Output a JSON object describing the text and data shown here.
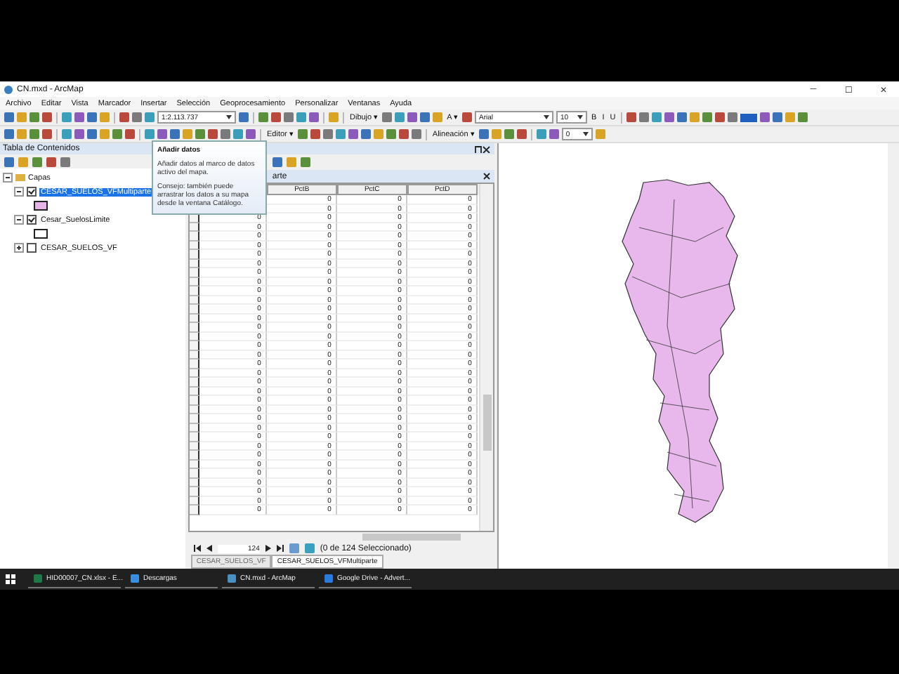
{
  "window": {
    "title": "CN.mxd - ArcMap",
    "controls": [
      "─",
      "☐",
      "✕"
    ]
  },
  "menu": [
    "Archivo",
    "Editar",
    "Vista",
    "Marcador",
    "Insertar",
    "Selección",
    "Geoprocesamiento",
    "Personalizar",
    "Ventanas",
    "Ayuda"
  ],
  "toolbar_1": [
    {
      "kind": "icon"
    },
    {
      "kind": "icon"
    },
    {
      "kind": "icon"
    },
    {
      "kind": "icon"
    },
    {
      "kind": "sep"
    },
    {
      "kind": "icon"
    },
    {
      "kind": "icon"
    },
    {
      "kind": "icon"
    },
    {
      "kind": "icon"
    },
    {
      "kind": "sep"
    },
    {
      "kind": "icon"
    },
    {
      "kind": "icon"
    },
    {
      "kind": "icon"
    },
    {
      "kind": "combo",
      "text": "1:2.113.737",
      "wide": true
    },
    {
      "kind": "icon"
    },
    {
      "kind": "sep"
    },
    {
      "kind": "icon"
    },
    {
      "kind": "icon"
    },
    {
      "kind": "icon"
    },
    {
      "kind": "icon"
    },
    {
      "kind": "icon"
    },
    {
      "kind": "sep"
    },
    {
      "kind": "icon"
    },
    {
      "kind": "sep"
    },
    {
      "kind": "label",
      "text": "Dibujo ▾"
    },
    {
      "kind": "icon"
    },
    {
      "kind": "icon"
    },
    {
      "kind": "icon"
    },
    {
      "kind": "icon"
    },
    {
      "kind": "icon"
    },
    {
      "kind": "label",
      "text": "A ▾"
    },
    {
      "kind": "icon"
    },
    {
      "kind": "combo",
      "text": "Arial",
      "wide": true
    },
    {
      "kind": "combo",
      "text": "10",
      "wide": false
    },
    {
      "kind": "label",
      "text": "B"
    },
    {
      "kind": "label",
      "text": "I"
    },
    {
      "kind": "label",
      "text": "U"
    },
    {
      "kind": "sep"
    },
    {
      "kind": "icon"
    },
    {
      "kind": "icon"
    },
    {
      "kind": "icon"
    },
    {
      "kind": "icon"
    },
    {
      "kind": "icon"
    },
    {
      "kind": "icon"
    },
    {
      "kind": "icon"
    },
    {
      "kind": "icon"
    },
    {
      "kind": "icon"
    },
    {
      "kind": "swatch"
    },
    {
      "kind": "icon"
    },
    {
      "kind": "icon"
    },
    {
      "kind": "icon"
    },
    {
      "kind": "icon"
    }
  ],
  "toolbar_2": [
    {
      "kind": "icon"
    },
    {
      "kind": "icon"
    },
    {
      "kind": "icon"
    },
    {
      "kind": "icon"
    },
    {
      "kind": "sep"
    },
    {
      "kind": "icon"
    },
    {
      "kind": "icon"
    },
    {
      "kind": "icon"
    },
    {
      "kind": "icon"
    },
    {
      "kind": "icon"
    },
    {
      "kind": "icon"
    },
    {
      "kind": "sep"
    },
    {
      "kind": "icon"
    },
    {
      "kind": "icon"
    },
    {
      "kind": "icon"
    },
    {
      "kind": "icon"
    },
    {
      "kind": "icon"
    },
    {
      "kind": "icon"
    },
    {
      "kind": "icon"
    },
    {
      "kind": "icon"
    },
    {
      "kind": "icon"
    },
    {
      "kind": "sep"
    },
    {
      "kind": "label",
      "text": "Editor ▾"
    },
    {
      "kind": "icon"
    },
    {
      "kind": "icon"
    },
    {
      "kind": "icon"
    },
    {
      "kind": "icon"
    },
    {
      "kind": "icon"
    },
    {
      "kind": "icon"
    },
    {
      "kind": "icon"
    },
    {
      "kind": "icon"
    },
    {
      "kind": "icon"
    },
    {
      "kind": "icon"
    },
    {
      "kind": "sep"
    },
    {
      "kind": "label",
      "text": "Alineación ▾"
    },
    {
      "kind": "icon"
    },
    {
      "kind": "icon"
    },
    {
      "kind": "icon"
    },
    {
      "kind": "icon"
    },
    {
      "kind": "sep"
    },
    {
      "kind": "icon"
    },
    {
      "kind": "icon"
    },
    {
      "kind": "combo",
      "text": "0",
      "wide": false
    },
    {
      "kind": "icon"
    }
  ],
  "toc": {
    "title": "Tabla de Contenidos",
    "root": "Capas",
    "layers": [
      {
        "name": "CESAR_SUELOS_VFMultiparte",
        "checked": true,
        "selected": true,
        "expanded": true,
        "color": "#e8b4e8"
      },
      {
        "name": "Cesar_SuelosLimite",
        "checked": true,
        "selected": false,
        "expanded": true,
        "color": "#ffffff"
      },
      {
        "name": "CESAR_SUELOS_VF",
        "checked": false,
        "selected": false,
        "expanded": false
      }
    ]
  },
  "table": {
    "window_title_tail": "arte",
    "columns": [
      "PctB",
      "PctC",
      "PctD"
    ],
    "rows": [
      [
        "0",
        "0",
        "0"
      ],
      [
        "0",
        "0",
        "0"
      ],
      [
        "0",
        "0",
        "0",
        "0"
      ],
      [
        "0",
        "0",
        "0",
        "0"
      ],
      [
        "0",
        "0",
        "0",
        "0"
      ],
      [
        "0",
        "0",
        "0",
        "0"
      ],
      [
        "0",
        "0",
        "0",
        "0"
      ],
      [
        "0",
        "0",
        "0",
        "0"
      ],
      [
        "0",
        "0",
        "0",
        "0"
      ],
      [
        "0",
        "0",
        "0",
        "0"
      ],
      [
        "0",
        "0",
        "0",
        "0"
      ],
      [
        "0",
        "0",
        "0",
        "0"
      ],
      [
        "0",
        "0",
        "0",
        "0"
      ],
      [
        "0",
        "0",
        "0",
        "0"
      ],
      [
        "0",
        "0",
        "0",
        "0"
      ],
      [
        "0",
        "0",
        "0",
        "0"
      ],
      [
        "0",
        "0",
        "0",
        "0"
      ],
      [
        "0",
        "0",
        "0",
        "0"
      ],
      [
        "0",
        "0",
        "0",
        "0"
      ],
      [
        "0",
        "0",
        "0",
        "0"
      ],
      [
        "0",
        "0",
        "0",
        "0"
      ],
      [
        "0",
        "0",
        "0",
        "0"
      ],
      [
        "0",
        "0",
        "0",
        "0"
      ],
      [
        "0",
        "0",
        "0",
        "0"
      ],
      [
        "0",
        "0",
        "0",
        "0"
      ],
      [
        "0",
        "0",
        "0",
        "0"
      ],
      [
        "0",
        "0",
        "0",
        "0"
      ],
      [
        "0",
        "0",
        "0",
        "0"
      ],
      [
        "0",
        "0",
        "0",
        "0"
      ],
      [
        "0",
        "0",
        "0",
        "0"
      ],
      [
        "0",
        "0",
        "0",
        "0"
      ],
      [
        "0",
        "0",
        "0",
        "0"
      ],
      [
        "0",
        "0",
        "0",
        "0"
      ],
      [
        "0",
        "0",
        "0",
        "0"
      ],
      [
        "0",
        "0",
        "0",
        "0"
      ]
    ],
    "record": "124",
    "selection": "(0 de 124 Seleccionado)",
    "tabs": [
      {
        "label": "CESAR_SUELOS_VF",
        "selected": false
      },
      {
        "label": "CESAR_SUELOS_VFMultiparte",
        "selected": true
      }
    ]
  },
  "tooltip": {
    "title": "Añadir datos",
    "body": "Añadir datos al marco de datos activo del mapa.",
    "tip": "Consejo: también puede arrastrar los datos a su mapa desde la ventana Catálogo."
  },
  "taskbar": [
    {
      "label": "HID00007_CN.xlsx - E...",
      "kind": "excel"
    },
    {
      "label": "Descargas",
      "kind": "folder"
    },
    {
      "label": "CN.mxd - ArcMap",
      "kind": "arcmap"
    },
    {
      "label": "Google Drive - Advert...",
      "kind": "browser"
    }
  ]
}
